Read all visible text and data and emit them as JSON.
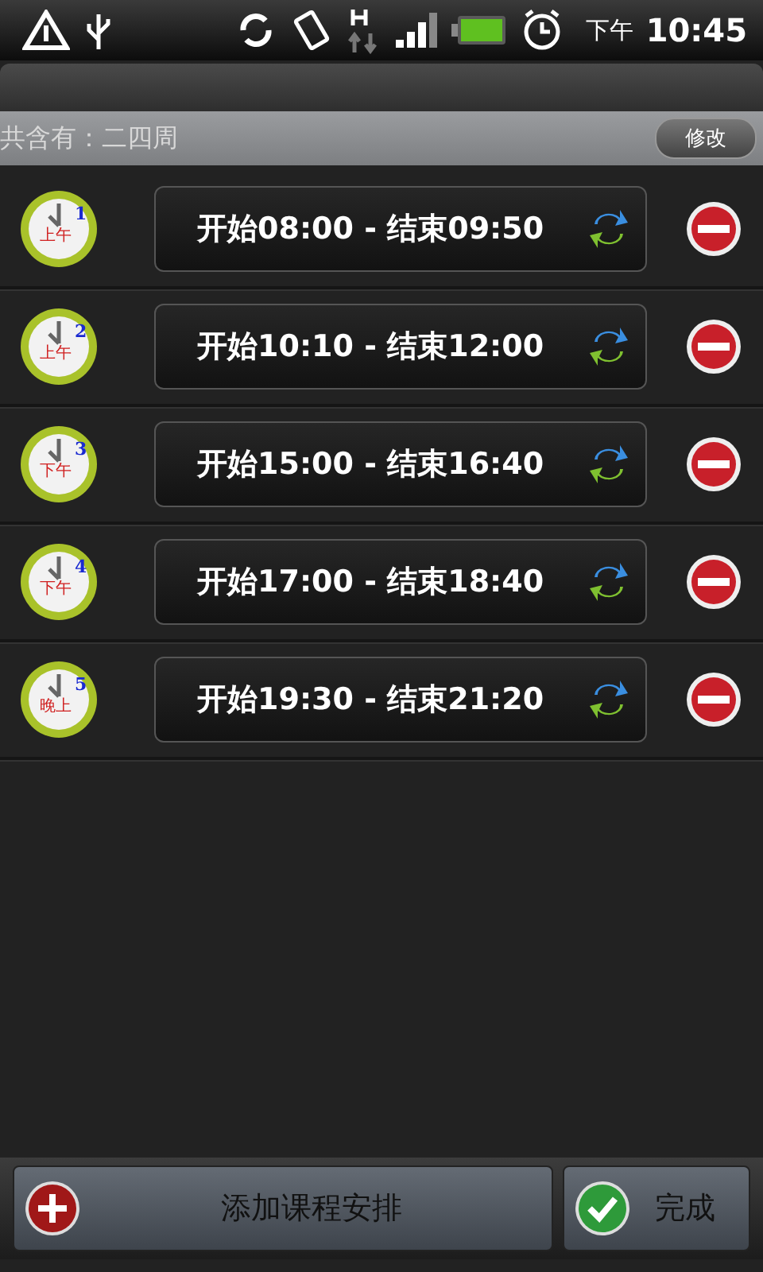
{
  "status_bar": {
    "period": "下午",
    "time": "10:45"
  },
  "header": {
    "label": "共含有：二四周",
    "button": "修改"
  },
  "sessions": [
    {
      "number": "1",
      "period": "上午",
      "text": "开始08:00 - 结束09:50"
    },
    {
      "number": "2",
      "period": "上午",
      "text": "开始10:10 - 结束12:00"
    },
    {
      "number": "3",
      "period": "下午",
      "text": "开始15:00 - 结束16:40"
    },
    {
      "number": "4",
      "period": "下午",
      "text": "开始17:00 - 结束18:40"
    },
    {
      "number": "5",
      "period": "晚上",
      "text": "开始19:30 - 结束21:20"
    }
  ],
  "buttons": [
    {
      "kind": "add",
      "label": "添加课程安排"
    },
    {
      "kind": "done",
      "label": "完成"
    }
  ]
}
